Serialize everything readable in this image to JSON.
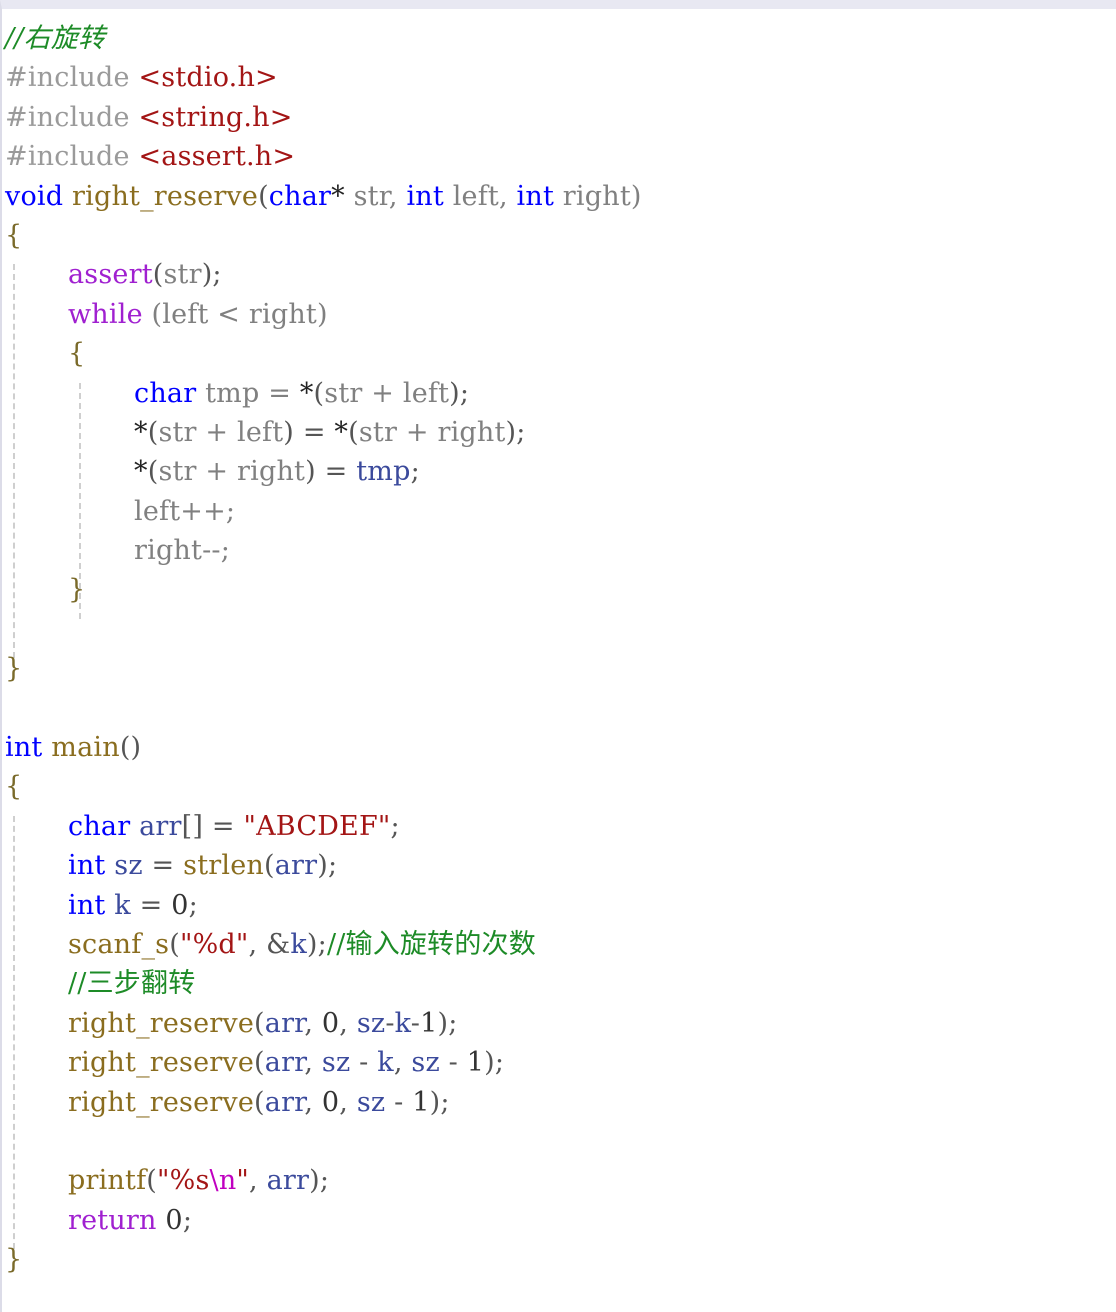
{
  "editor": {
    "language": "C",
    "background": "#ffffff",
    "top_bar_color": "#e8e8f2",
    "indent_guide_color": "#cfcfcf",
    "font_size_px": 27,
    "line_height_px": 39.4
  },
  "palette": {
    "keyword": "#0000ff",
    "control_keyword": "#a020d0",
    "function_name": "#8a6d1f",
    "identifier": "#808080",
    "local_variable": "#3b4a9c",
    "preprocessor": "#9a9a9a",
    "header_name": "#a31515",
    "string": "#a31515",
    "escape": "#c000c0",
    "comment": "#1d8b27",
    "brace": "#7a6a2a"
  },
  "code": {
    "title": "right rotate string - three step reversal",
    "lines": [
      {
        "n": 1,
        "indent": 0,
        "text": "//右旋转"
      },
      {
        "n": 2,
        "indent": 0,
        "text": "#include <stdio.h>"
      },
      {
        "n": 3,
        "indent": 0,
        "text": "#include <string.h>"
      },
      {
        "n": 4,
        "indent": 0,
        "text": "#include <assert.h>"
      },
      {
        "n": 5,
        "indent": 0,
        "text": "void right_reserve(char* str, int left, int right)"
      },
      {
        "n": 6,
        "indent": 0,
        "text": "{"
      },
      {
        "n": 7,
        "indent": 1,
        "text": "assert(str);"
      },
      {
        "n": 8,
        "indent": 1,
        "text": "while (left < right)"
      },
      {
        "n": 9,
        "indent": 1,
        "text": "{"
      },
      {
        "n": 10,
        "indent": 2,
        "text": "char tmp = *(str + left);"
      },
      {
        "n": 11,
        "indent": 2,
        "text": "*(str + left) = *(str + right);"
      },
      {
        "n": 12,
        "indent": 2,
        "text": "*(str + right) = tmp;"
      },
      {
        "n": 13,
        "indent": 2,
        "text": "left++;"
      },
      {
        "n": 14,
        "indent": 2,
        "text": "right--;"
      },
      {
        "n": 15,
        "indent": 1,
        "text": "}"
      },
      {
        "n": 16,
        "indent": 1,
        "text": ""
      },
      {
        "n": 17,
        "indent": 0,
        "text": "}"
      },
      {
        "n": 18,
        "indent": 0,
        "text": ""
      },
      {
        "n": 19,
        "indent": 0,
        "text": "int main()"
      },
      {
        "n": 20,
        "indent": 0,
        "text": "{"
      },
      {
        "n": 21,
        "indent": 1,
        "text": "char arr[] = \"ABCDEF\";"
      },
      {
        "n": 22,
        "indent": 1,
        "text": "int sz = strlen(arr);"
      },
      {
        "n": 23,
        "indent": 1,
        "text": "int k = 0;"
      },
      {
        "n": 24,
        "indent": 1,
        "text": "scanf_s(\"%d\", &k);//输入旋转的次数"
      },
      {
        "n": 25,
        "indent": 1,
        "text": "//三步翻转"
      },
      {
        "n": 26,
        "indent": 1,
        "text": "right_reserve(arr, 0, sz-k-1);"
      },
      {
        "n": 27,
        "indent": 1,
        "text": "right_reserve(arr, sz - k, sz - 1);"
      },
      {
        "n": 28,
        "indent": 1,
        "text": "right_reserve(arr, 0, sz - 1);"
      },
      {
        "n": 29,
        "indent": 1,
        "text": ""
      },
      {
        "n": 30,
        "indent": 1,
        "text": "printf(\"%s\\n\", arr);"
      },
      {
        "n": 31,
        "indent": 1,
        "text": "return 0;"
      },
      {
        "n": 32,
        "indent": 0,
        "text": "}"
      }
    ],
    "tokens": {
      "l1": [
        {
          "c": "cmt",
          "t": "//右旋转"
        }
      ],
      "l2": [
        {
          "c": "pp",
          "t": "#include "
        },
        {
          "c": "hdr",
          "t": "<stdio.h>"
        }
      ],
      "l3": [
        {
          "c": "pp",
          "t": "#include "
        },
        {
          "c": "hdr",
          "t": "<string.h>"
        }
      ],
      "l4": [
        {
          "c": "pp",
          "t": "#include "
        },
        {
          "c": "hdr",
          "t": "<assert.h>"
        }
      ],
      "l5": [
        {
          "c": "kw",
          "t": "void"
        },
        {
          "c": "ident",
          "t": " "
        },
        {
          "c": "fn",
          "t": "right_reserve"
        },
        {
          "c": "punct",
          "t": "("
        },
        {
          "c": "kw",
          "t": "char"
        },
        {
          "c": "op",
          "t": "*"
        },
        {
          "c": "ident",
          "t": " str, "
        },
        {
          "c": "kw",
          "t": "int"
        },
        {
          "c": "ident",
          "t": " left, "
        },
        {
          "c": "kw",
          "t": "int"
        },
        {
          "c": "ident",
          "t": " right)"
        }
      ],
      "l6": [
        {
          "c": "brace",
          "t": "{"
        }
      ],
      "l7": [
        {
          "c": "ctrl",
          "t": "assert"
        },
        {
          "c": "punct",
          "t": "("
        },
        {
          "c": "ident",
          "t": "str"
        },
        {
          "c": "punct",
          "t": ");"
        }
      ],
      "l8": [
        {
          "c": "ctrl",
          "t": "while"
        },
        {
          "c": "ident",
          "t": " (left < right)"
        }
      ],
      "l9": [
        {
          "c": "brace",
          "t": "{"
        }
      ],
      "l10": [
        {
          "c": "kw",
          "t": "char"
        },
        {
          "c": "ident",
          "t": " tmp = "
        },
        {
          "c": "op",
          "t": "*"
        },
        {
          "c": "punct",
          "t": "("
        },
        {
          "c": "ident",
          "t": "str + left"
        },
        {
          "c": "punct",
          "t": ");"
        }
      ],
      "l11": [
        {
          "c": "op",
          "t": "*"
        },
        {
          "c": "punct",
          "t": "("
        },
        {
          "c": "ident",
          "t": "str + left"
        },
        {
          "c": "punct",
          "t": ") = "
        },
        {
          "c": "op",
          "t": "*"
        },
        {
          "c": "punct",
          "t": "("
        },
        {
          "c": "ident",
          "t": "str + right"
        },
        {
          "c": "punct",
          "t": ");"
        }
      ],
      "l12": [
        {
          "c": "op",
          "t": "*"
        },
        {
          "c": "punct",
          "t": "("
        },
        {
          "c": "ident",
          "t": "str + right"
        },
        {
          "c": "punct",
          "t": ") = "
        },
        {
          "c": "var",
          "t": "tmp"
        },
        {
          "c": "punct",
          "t": ";"
        }
      ],
      "l13": [
        {
          "c": "ident",
          "t": "left++;"
        }
      ],
      "l14": [
        {
          "c": "ident",
          "t": "right--;"
        }
      ],
      "l15": [
        {
          "c": "brace",
          "t": "}"
        }
      ],
      "l17": [
        {
          "c": "brace",
          "t": "}"
        }
      ],
      "l19": [
        {
          "c": "kw",
          "t": "int"
        },
        {
          "c": "ident",
          "t": " "
        },
        {
          "c": "fn",
          "t": "main"
        },
        {
          "c": "punct",
          "t": "()"
        }
      ],
      "l20": [
        {
          "c": "brace",
          "t": "{"
        }
      ],
      "l21": [
        {
          "c": "kw",
          "t": "char"
        },
        {
          "c": "var",
          "t": " arr"
        },
        {
          "c": "punct",
          "t": "[] = "
        },
        {
          "c": "str",
          "t": "\"ABCDEF\""
        },
        {
          "c": "punct",
          "t": ";"
        }
      ],
      "l22": [
        {
          "c": "kw",
          "t": "int"
        },
        {
          "c": "var",
          "t": " sz"
        },
        {
          "c": "punct",
          "t": " = "
        },
        {
          "c": "fn",
          "t": "strlen"
        },
        {
          "c": "punct",
          "t": "("
        },
        {
          "c": "var",
          "t": "arr"
        },
        {
          "c": "punct",
          "t": ");"
        }
      ],
      "l23": [
        {
          "c": "kw",
          "t": "int"
        },
        {
          "c": "var",
          "t": " k"
        },
        {
          "c": "punct",
          "t": " = "
        },
        {
          "c": "num",
          "t": "0"
        },
        {
          "c": "punct",
          "t": ";"
        }
      ],
      "l24": [
        {
          "c": "fn",
          "t": "scanf_s"
        },
        {
          "c": "punct",
          "t": "("
        },
        {
          "c": "str",
          "t": "\"%d\""
        },
        {
          "c": "punct",
          "t": ", &"
        },
        {
          "c": "var",
          "t": "k"
        },
        {
          "c": "punct",
          "t": ");"
        },
        {
          "c": "cmt-cn",
          "t": "//输入旋转的次数"
        }
      ],
      "l25": [
        {
          "c": "cmt-cn",
          "t": "//三步翻转"
        }
      ],
      "l26": [
        {
          "c": "fn",
          "t": "right_reserve"
        },
        {
          "c": "punct",
          "t": "("
        },
        {
          "c": "var",
          "t": "arr"
        },
        {
          "c": "punct",
          "t": ", "
        },
        {
          "c": "num",
          "t": "0"
        },
        {
          "c": "punct",
          "t": ", "
        },
        {
          "c": "var",
          "t": "sz"
        },
        {
          "c": "punct",
          "t": "-"
        },
        {
          "c": "var",
          "t": "k"
        },
        {
          "c": "punct",
          "t": "-"
        },
        {
          "c": "num",
          "t": "1"
        },
        {
          "c": "punct",
          "t": ");"
        }
      ],
      "l27": [
        {
          "c": "fn",
          "t": "right_reserve"
        },
        {
          "c": "punct",
          "t": "("
        },
        {
          "c": "var",
          "t": "arr"
        },
        {
          "c": "punct",
          "t": ", "
        },
        {
          "c": "var",
          "t": "sz"
        },
        {
          "c": "punct",
          "t": " - "
        },
        {
          "c": "var",
          "t": "k"
        },
        {
          "c": "punct",
          "t": ", "
        },
        {
          "c": "var",
          "t": "sz"
        },
        {
          "c": "punct",
          "t": " - "
        },
        {
          "c": "num",
          "t": "1"
        },
        {
          "c": "punct",
          "t": ");"
        }
      ],
      "l28": [
        {
          "c": "fn",
          "t": "right_reserve"
        },
        {
          "c": "punct",
          "t": "("
        },
        {
          "c": "var",
          "t": "arr"
        },
        {
          "c": "punct",
          "t": ", "
        },
        {
          "c": "num",
          "t": "0"
        },
        {
          "c": "punct",
          "t": ", "
        },
        {
          "c": "var",
          "t": "sz"
        },
        {
          "c": "punct",
          "t": " - "
        },
        {
          "c": "num",
          "t": "1"
        },
        {
          "c": "punct",
          "t": ");"
        }
      ],
      "l30": [
        {
          "c": "fn",
          "t": "printf"
        },
        {
          "c": "punct",
          "t": "("
        },
        {
          "c": "str",
          "t": "\"%s"
        },
        {
          "c": "esc",
          "t": "\\n"
        },
        {
          "c": "str",
          "t": "\""
        },
        {
          "c": "punct",
          "t": ", "
        },
        {
          "c": "var",
          "t": "arr"
        },
        {
          "c": "punct",
          "t": ");"
        }
      ],
      "l31": [
        {
          "c": "ctrl",
          "t": "return"
        },
        {
          "c": "punct",
          "t": " "
        },
        {
          "c": "num",
          "t": "0"
        },
        {
          "c": "punct",
          "t": ";"
        }
      ],
      "l32": [
        {
          "c": "brace",
          "t": "}"
        }
      ]
    }
  }
}
